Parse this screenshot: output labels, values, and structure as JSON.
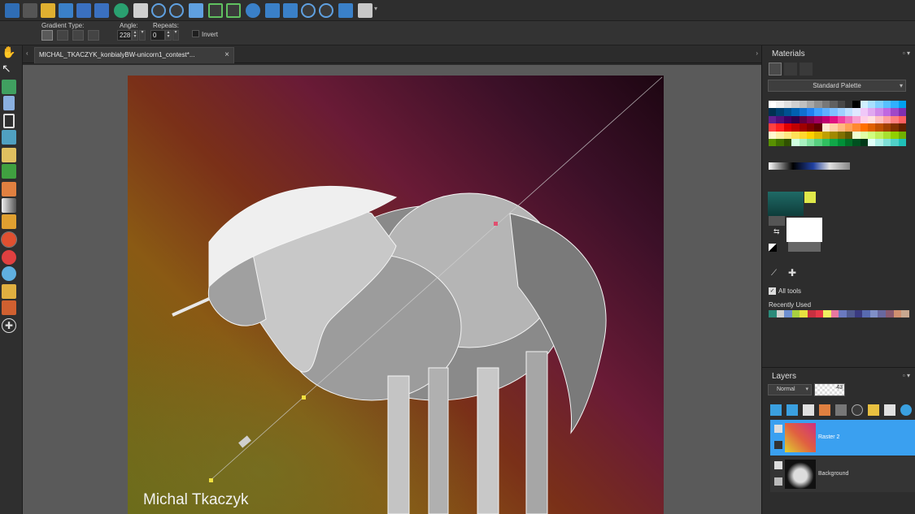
{
  "options": {
    "gradient_type_label": "Gradient Type:",
    "angle_label": "Angle:",
    "angle_value": "228",
    "repeats_label": "Repeats:",
    "repeats_value": "0",
    "invert_label": "Invert"
  },
  "document": {
    "tab_title": "MICHAL_TKACZYK_konbialyBW-unicorn1_contest*...",
    "close_glyph": "×",
    "watermark": "Michal Tkaczyk"
  },
  "materials": {
    "title": "Materials",
    "palette_name": "Standard Palette",
    "all_tools_label": "All tools",
    "recently_used_label": "Recently Used",
    "foreground_color": "#1f6a66",
    "background_color": "#dfe84a",
    "swatch_rows": [
      [
        "#ffffff",
        "#f0f0f0",
        "#e0e0e0",
        "#d0d0d0",
        "#c0c0c0",
        "#a8a8a8",
        "#909090",
        "#787878",
        "#606060",
        "#484848",
        "#303030",
        "#000000",
        "#d0f0ff",
        "#a8e0ff",
        "#80d0ff",
        "#58c0ff",
        "#30b0ff",
        "#00a0f0"
      ],
      [
        "#003050",
        "#004070",
        "#005090",
        "#0060b0",
        "#1070d0",
        "#2080f0",
        "#40a0ff",
        "#60b0ff",
        "#80c0ff",
        "#a0d0ff",
        "#c0e0ff",
        "#dfe8ff",
        "#f0c8f8",
        "#e0a8f0",
        "#d088e8",
        "#c068e0",
        "#a048c8",
        "#8030b0"
      ],
      [
        "#602090",
        "#501078",
        "#400060",
        "#300048",
        "#600040",
        "#800050",
        "#a00060",
        "#c00070",
        "#e01080",
        "#f040a0",
        "#f070b8",
        "#f8a0d0",
        "#ffd0e8",
        "#ffe0e0",
        "#ffc0c0",
        "#ffa0a0",
        "#ff8080",
        "#ff6060"
      ],
      [
        "#ff4040",
        "#ff2020",
        "#e00000",
        "#c00000",
        "#a00000",
        "#800000",
        "#600000",
        "#ffe8d0",
        "#ffd0a8",
        "#ffb880",
        "#ffa058",
        "#ff8830",
        "#ff7000",
        "#e06000",
        "#c05000",
        "#a04000",
        "#803000",
        "#602000"
      ],
      [
        "#fff8d0",
        "#fff0a8",
        "#ffe880",
        "#ffe058",
        "#ffd830",
        "#ffd000",
        "#e0b800",
        "#c0a000",
        "#a08800",
        "#807000",
        "#605800",
        "#f0ffd0",
        "#e0ffa8",
        "#d0ff80",
        "#c0f058",
        "#a8e030",
        "#90d000",
        "#70b000"
      ],
      [
        "#589000",
        "#407000",
        "#305000",
        "#d0ffe0",
        "#a8f0c0",
        "#80e0a0",
        "#58d080",
        "#30c060",
        "#10a848",
        "#009038",
        "#007028",
        "#005020",
        "#003818",
        "#e0fff8",
        "#b0f0e8",
        "#80e0d8",
        "#50d0c8",
        "#20c0b8"
      ]
    ],
    "recent_colors": [
      "#2a8a7a",
      "#d0d0d0",
      "#6e8fd0",
      "#a8d040",
      "#e8e040",
      "#c83040",
      "#e83848",
      "#f0f060",
      "#e878a0",
      "#6a7ac0",
      "#505a90",
      "#3a3a80",
      "#586ab0",
      "#8090c8",
      "#6868a0",
      "#8a5a70",
      "#d09070",
      "#c8a890"
    ]
  },
  "layers": {
    "title": "Layers",
    "blend_mode": "Normal",
    "opacity": "43",
    "items": [
      {
        "name": "Raster 2"
      },
      {
        "name": "Background"
      }
    ]
  },
  "icons": {
    "pan": "✋",
    "pointer": "↖",
    "add": "✚",
    "check": "✓",
    "chevron_down": "▾",
    "menu": "▾"
  }
}
